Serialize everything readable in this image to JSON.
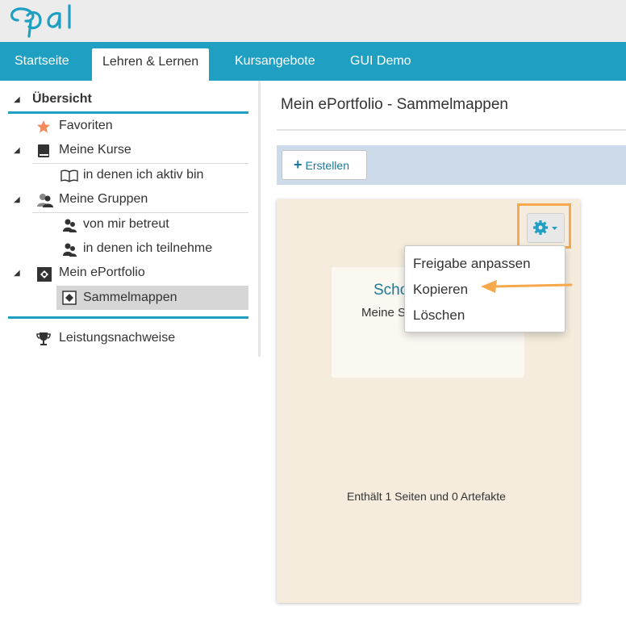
{
  "app": {
    "logo_text": "Opal"
  },
  "nav": {
    "tabs": [
      {
        "label": "Startseite",
        "active": false
      },
      {
        "label": "Lehren & Lernen",
        "active": true
      },
      {
        "label": "Kursangebote",
        "active": false
      },
      {
        "label": "GUI Demo",
        "active": false
      }
    ]
  },
  "sidebar": {
    "items": [
      {
        "label": "Übersicht",
        "icon": "triangle-down-icon",
        "level": 0,
        "expanded": true
      },
      {
        "label": "Favoriten",
        "icon": "star-icon",
        "level": 1
      },
      {
        "label": "Meine Kurse",
        "icon": "book-icon",
        "level": 1,
        "expanded": true
      },
      {
        "label": "in denen ich aktiv bin",
        "icon": "open-book-icon",
        "level": 2
      },
      {
        "label": "Meine Gruppen",
        "icon": "group-icon",
        "level": 1,
        "expanded": true
      },
      {
        "label": "von mir betreut",
        "icon": "user-group-icon",
        "level": 2
      },
      {
        "label": "in denen ich teilnehme",
        "icon": "user-group-icon",
        "level": 2
      },
      {
        "label": "Mein ePortfolio",
        "icon": "puzzle-icon",
        "level": 1,
        "expanded": true
      },
      {
        "label": "Sammelmappen",
        "icon": "puzzle-icon",
        "level": 2,
        "selected": true
      },
      {
        "label": "Leistungsnachweise",
        "icon": "trophy-icon",
        "level": 1
      }
    ]
  },
  "main": {
    "title": "Mein ePortfolio - Sammelmappen",
    "toolbar": {
      "create_label": "Erstellen"
    },
    "card": {
      "title_partial": "Scho",
      "subtitle_partial": "Meine S",
      "footer": "Enthält 1 Seiten und 0 Artefakte"
    },
    "dropdown": {
      "items": [
        "Freigabe anpassen",
        "Kopieren",
        "Löschen"
      ]
    }
  },
  "colors": {
    "accent": "#1fa0c3",
    "card_bg": "#f5ecdd",
    "highlight": "#f5a94c",
    "toolbar_bg": "#ccdae9"
  }
}
